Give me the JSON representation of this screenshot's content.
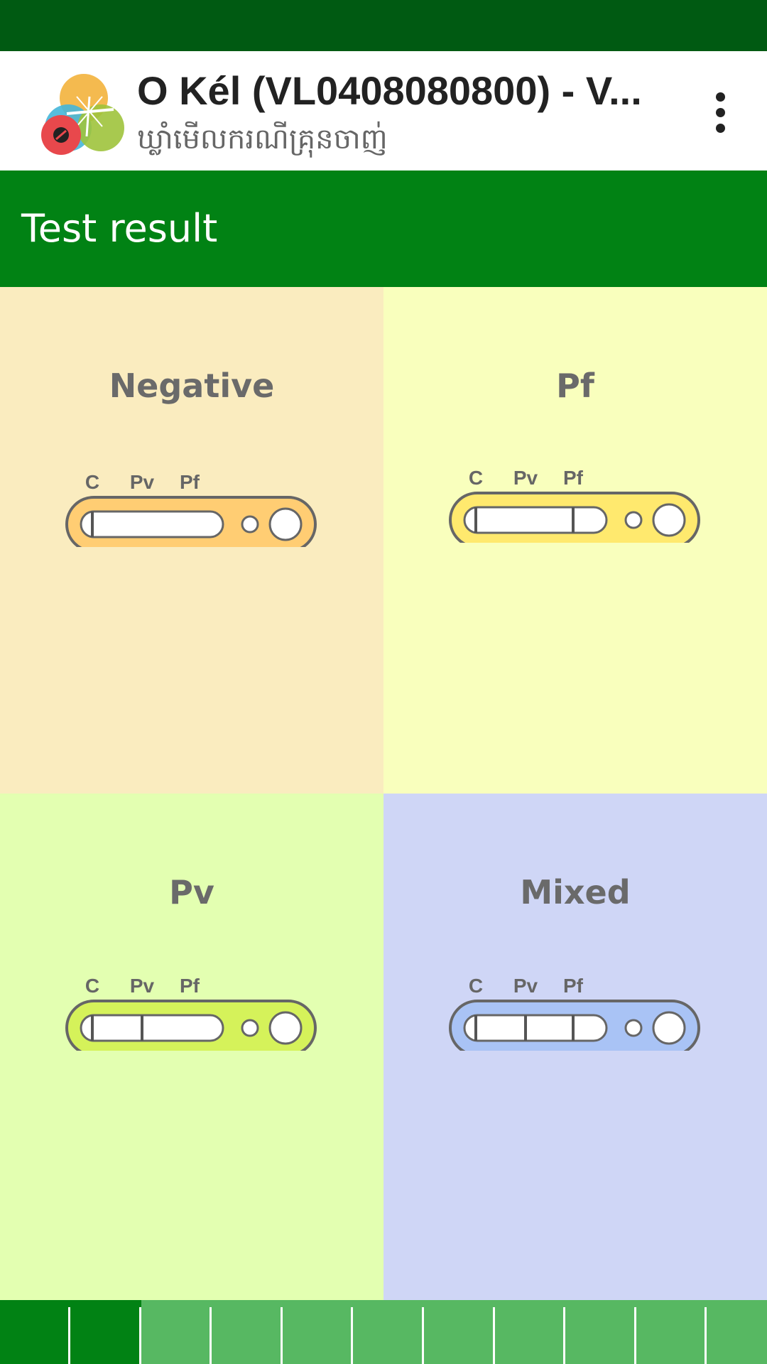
{
  "app": {
    "title": "O Kél (VL0408080800) - V...",
    "subtitle": "ឃ្លាំមើលករណីគ្រុនចាញ់",
    "logo_icon": "malaria-app-logo-icon",
    "menu_icon": "more-vertical-icon"
  },
  "section": {
    "title": "Test result"
  },
  "results": [
    {
      "label": "Negative",
      "color": "#faecbf",
      "cassette_color": "#ffcd73",
      "lines": [
        "C"
      ],
      "strip_labels": [
        "C",
        "Pv",
        "Pf"
      ]
    },
    {
      "label": "Pf",
      "color": "#f9ffbd",
      "cassette_color": "#ffe96e",
      "lines": [
        "C",
        "Pf"
      ],
      "strip_labels": [
        "C",
        "Pv",
        "Pf"
      ]
    },
    {
      "label": "Pv",
      "color": "#e3ffb1",
      "cassette_color": "#d5f25a",
      "lines": [
        "C",
        "Pv"
      ],
      "strip_labels": [
        "C",
        "Pv",
        "Pf"
      ]
    },
    {
      "label": "Mixed",
      "color": "#cfd6f6",
      "cassette_color": "#a9c3f5",
      "lines": [
        "C",
        "Pv",
        "Pf"
      ],
      "strip_labels": [
        "C",
        "Pv",
        "Pf"
      ]
    }
  ],
  "progress": {
    "total_steps": 11,
    "current_step": 2
  }
}
